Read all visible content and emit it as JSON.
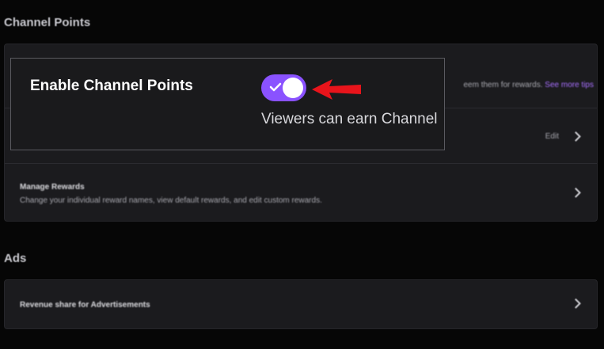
{
  "sections": {
    "channel_points_title": "Channel Points",
    "ads_title": "Ads"
  },
  "channel_points_card": {
    "intro_text": "eem them for rewards.",
    "see_more_link": "See more tips",
    "edit_label": "Edit",
    "manage_rewards": {
      "title": "Manage Rewards",
      "description": "Change your individual reward names, view default rewards, and edit custom rewards."
    }
  },
  "ads_card": {
    "revenue_share_label": "Revenue share for Advertisements"
  },
  "callout": {
    "title": "Enable Channel Points",
    "subtitle": "Viewers can earn Channel",
    "toggle_state": "on"
  },
  "colors": {
    "accent": "#8a52ff",
    "link": "#a970ff",
    "arrow": "#e8141b",
    "background": "#060606",
    "card": "#1b1b1e"
  },
  "icons": {
    "toggle_check": "check-icon",
    "row_chevron": "chevron-right-icon",
    "annotation": "red-arrow-icon"
  }
}
